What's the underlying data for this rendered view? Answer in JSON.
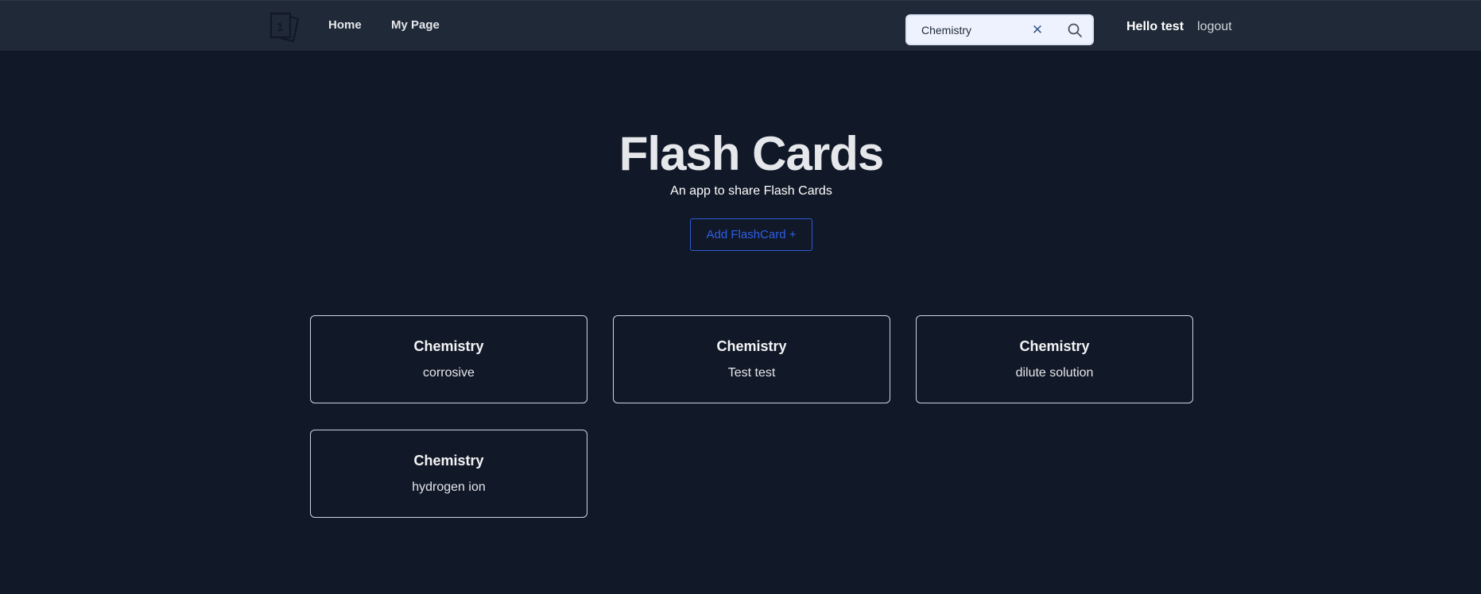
{
  "nav": {
    "home": "Home",
    "my_page": "My Page",
    "logo_glyph": "1"
  },
  "search": {
    "value": "Chemistry",
    "clear_label": "✕"
  },
  "user": {
    "greeting": "Hello test",
    "logout": "logout"
  },
  "hero": {
    "title": "Flash Cards",
    "subtitle": "An app to share Flash Cards",
    "add_button": "Add FlashCard +"
  },
  "cards": [
    {
      "title": "Chemistry",
      "text": "corrosive"
    },
    {
      "title": "Chemistry",
      "text": "Test test"
    },
    {
      "title": "Chemistry",
      "text": "dilute solution"
    },
    {
      "title": "Chemistry",
      "text": "hydrogen ion"
    }
  ],
  "colors": {
    "background": "#111827",
    "navbar": "#1f2937",
    "accent": "#2f5fe8",
    "card_border": "#cbd5e1"
  },
  "icons": {
    "logo": "flash-cards-logo-icon",
    "clear": "close-icon",
    "search": "search-icon"
  }
}
